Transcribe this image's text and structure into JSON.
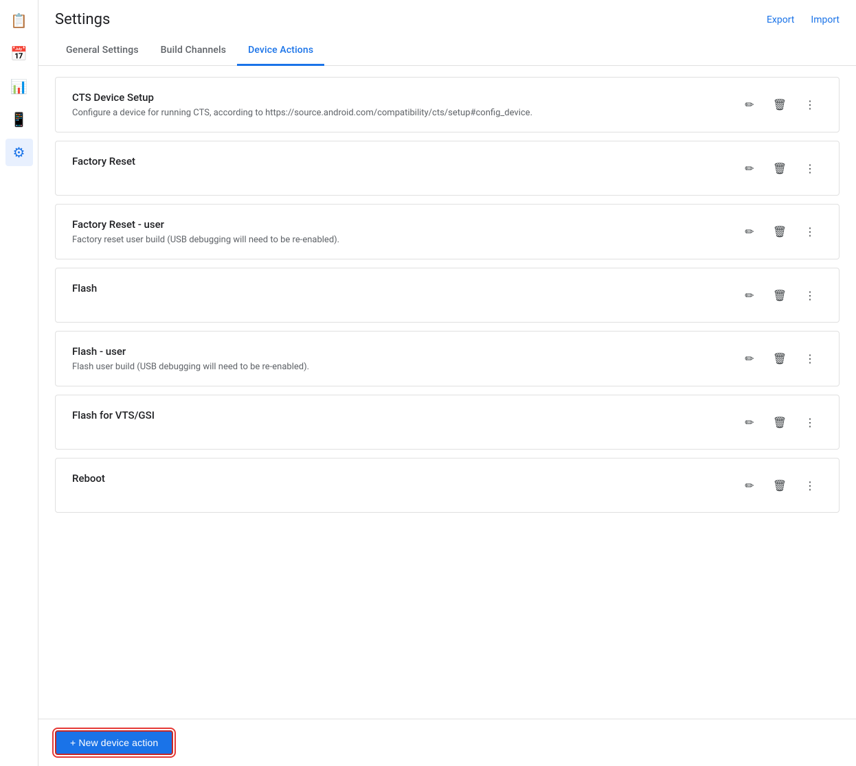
{
  "page": {
    "title": "Settings"
  },
  "header": {
    "export_label": "Export",
    "import_label": "Import"
  },
  "tabs": [
    {
      "id": "general",
      "label": "General Settings",
      "active": false
    },
    {
      "id": "build-channels",
      "label": "Build Channels",
      "active": false
    },
    {
      "id": "device-actions",
      "label": "Device Actions",
      "active": true
    }
  ],
  "sidebar": {
    "items": [
      {
        "id": "clipboard",
        "icon": "📋",
        "active": false
      },
      {
        "id": "calendar",
        "icon": "📅",
        "active": false
      },
      {
        "id": "chart",
        "icon": "📊",
        "active": false
      },
      {
        "id": "device",
        "icon": "📱",
        "active": false
      },
      {
        "id": "settings",
        "icon": "⚙",
        "active": true
      }
    ]
  },
  "actions": [
    {
      "id": "cts-device-setup",
      "title": "CTS Device Setup",
      "description": "Configure a device for running CTS, according to https://source.android.com/compatibility/cts/setup#config_device."
    },
    {
      "id": "factory-reset",
      "title": "Factory Reset",
      "description": ""
    },
    {
      "id": "factory-reset-user",
      "title": "Factory Reset - user",
      "description": "Factory reset user build (USB debugging will need to be re-enabled)."
    },
    {
      "id": "flash",
      "title": "Flash",
      "description": ""
    },
    {
      "id": "flash-user",
      "title": "Flash - user",
      "description": "Flash user build (USB debugging will need to be re-enabled)."
    },
    {
      "id": "flash-vts-gsi",
      "title": "Flash for VTS/GSI",
      "description": ""
    },
    {
      "id": "reboot",
      "title": "Reboot",
      "description": ""
    }
  ],
  "bottom_bar": {
    "new_action_label": "+ New device action"
  },
  "icons": {
    "pencil": "✏",
    "trash": "🗑",
    "more": "⋮"
  }
}
